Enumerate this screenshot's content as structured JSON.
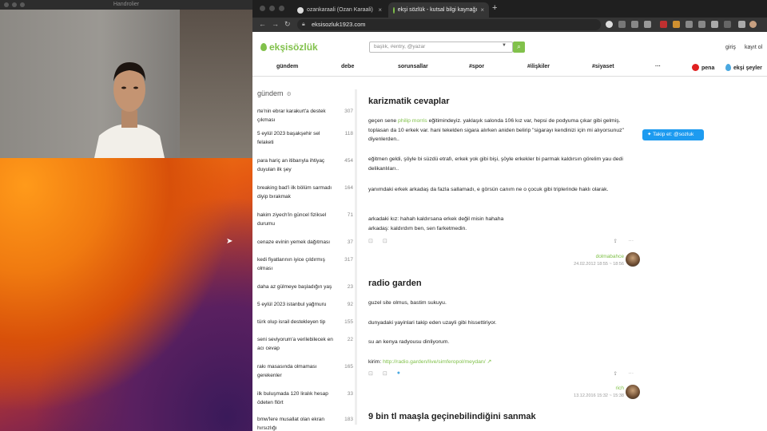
{
  "camera_window": {
    "title": "Handrolier"
  },
  "browser": {
    "tabs": [
      {
        "label": "ozankaraali (Ozan Karaali)",
        "close": "×"
      },
      {
        "label": "ekşi sözlük - kutsal bilgi kaynağı",
        "close": "×"
      }
    ],
    "new_tab": "+",
    "url": "eksisozluk1923.com",
    "nav": {
      "back": "←",
      "forward": "→",
      "reload": "↻"
    }
  },
  "site": {
    "logo_part1": "ekşi",
    "logo_part2": "sözlük",
    "search_placeholder": "başlık, #entry, @yazar",
    "login": "giriş",
    "register": "kayıt ol",
    "nav": [
      "gündem",
      "debe",
      "sorunsallar",
      "#spor",
      "#ilişkiler",
      "#siyaset",
      "···"
    ],
    "pena": "pena",
    "seyler": "ekşi şeyler",
    "twitter": "Takip et: @sozluk"
  },
  "sidebar": {
    "title": "gündem",
    "topics": [
      {
        "title": "rte'nin ebrar karakurt'a destek çıkması",
        "count": "307"
      },
      {
        "title": "5 eylül 2023 başakşehir sel felaketi",
        "count": "118"
      },
      {
        "title": "para hariç an itibarıyla ihtiyaç duyulan ilk şey",
        "count": "454"
      },
      {
        "title": "breaking bad'i ilk bölüm sarmadı diyip bırakmak",
        "count": "164"
      },
      {
        "title": "hakim ziyech'in güncel fiziksel durumu",
        "count": "71"
      },
      {
        "title": "cenaze evinin yemek dağıtması",
        "count": "37"
      },
      {
        "title": "kedi fiyatlarının iyice çıldırmış olması",
        "count": "317"
      },
      {
        "title": "daha az gülmeye başladığın yaş",
        "count": "23"
      },
      {
        "title": "5 eylül 2023 istanbul yağmuru",
        "count": "92"
      },
      {
        "title": "türk olup israil destekleyen tip",
        "count": "155"
      },
      {
        "title": "seni seviyorum'a verilebilecek en acı cevap",
        "count": "22"
      },
      {
        "title": "rakı masasında olmaması gerekenler",
        "count": "165"
      },
      {
        "title": "ilk buluşmada 120 liralık hesap ödeten flört",
        "count": "33"
      },
      {
        "title": "bmw'lere musallat olan ekran hırsızlığı",
        "count": "183"
      }
    ]
  },
  "entries": [
    {
      "title": "karizmatik cevaplar",
      "p1_a": "geçen sene ",
      "p1_link": "philip morris",
      "p1_b": " eğitimindeyiz. yaklaşık salonda 106 kız var, hepsi de podyuma çıkar gibi gelmiş. toplasan da 10 erkek var. hani tekelden sigara alırken aniden belirip \"sigarayı kendinizi için mi alıyorsunuz\" diyenlerden..",
      "p2": "eğitmen geldi, şöyle bi süzdü etrafı, erkek yok gibi bişi, şöyle erkekler bi parmak kaldırsın görelim yau dedi delikanlıları..",
      "p3": "yanımdaki erkek arkadaş da fazla sallamadı, e görsün canım ne o çocuk gibi triplerinde haklı olarak.",
      "p4": "arkadaki kız: hahah kaldırsana erkek değil misin hahaha",
      "p5": "arkadaş: kaldırdım ben, sen farketmedin.",
      "author": "dolmabahce",
      "date": "24.02.2012 18:55 ~ 18:56"
    },
    {
      "title": "radio garden",
      "p1": "guzel site olmus, bastim sukuyu.",
      "p2": "dunyadaki yayinlari takip eden uzayli gibi hissettiriyor.",
      "p3": "su an kenya radyousu dinliyorum.",
      "p4_a": "kirim: ",
      "p4_link": "http://radio.garden/live/simferopol/meydan/",
      "author": "rich",
      "date": "13.12.2016 15:32 ~ 15:38"
    },
    {
      "title": "9 bin tl maaşla geçinebilindiğini sanmak"
    }
  ],
  "colors": {
    "brand": "#81c14b",
    "twitter": "#1d9bf0",
    "pena": "#e02020"
  }
}
